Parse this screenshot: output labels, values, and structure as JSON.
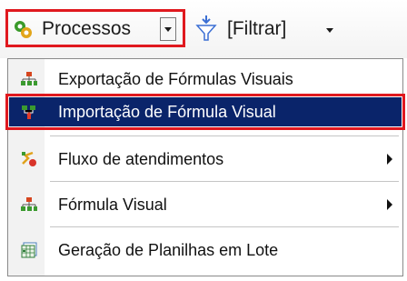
{
  "toolbar": {
    "processes_label": "Processos",
    "filter_label": "[Filtrar]",
    "processes_icon": "gears-icon",
    "filter_icon": "funnel-icon"
  },
  "menu": {
    "items": [
      {
        "label": "Exportação de Fórmulas Visuais",
        "icon": "export-diagram-icon",
        "submenu": false,
        "selected": false
      },
      {
        "label": "Importação de Fórmula Visual",
        "icon": "import-diagram-icon",
        "submenu": false,
        "selected": true
      },
      {
        "label": "Fluxo de atendimentos",
        "icon": "flow-icon",
        "submenu": true,
        "selected": false
      },
      {
        "label": "Fórmula Visual",
        "icon": "visual-formula-icon",
        "submenu": true,
        "selected": false
      },
      {
        "label": "Geração de Planilhas em Lote",
        "icon": "spreadsheet-icon",
        "submenu": false,
        "selected": false
      }
    ]
  },
  "colors": {
    "highlight": "#e0191f",
    "selection": "#0a246a"
  }
}
